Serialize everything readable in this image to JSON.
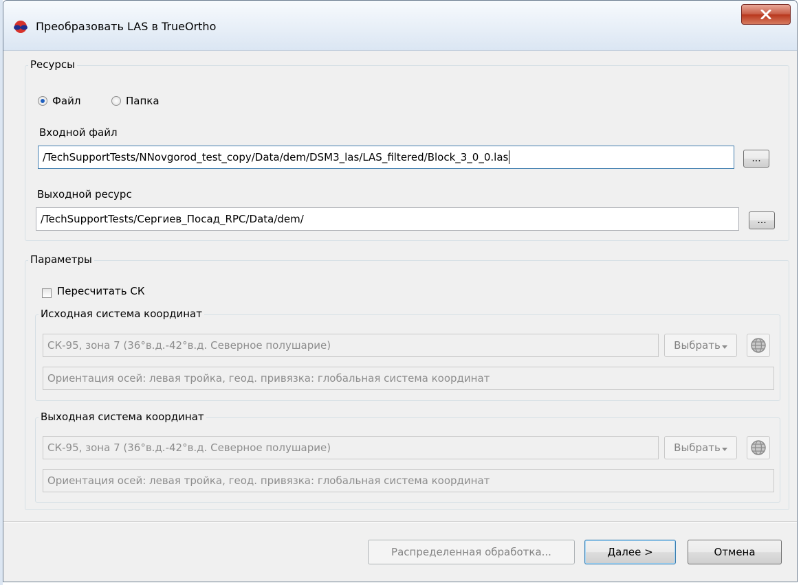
{
  "window": {
    "title": "Преобразовать LAS в TrueOrtho",
    "close_label": "X"
  },
  "resources": {
    "group_title": "Ресурсы",
    "mode_file_label": "Файл",
    "mode_folder_label": "Папка",
    "mode_selected": "file",
    "input_label": "Входной файл",
    "input_value": "/TechSupportTests/NNovgorod_test_copy/Data/dem/DSM3_las/LAS_filtered/Block_3_0_0.las",
    "output_label": "Выходной ресурс",
    "output_value": "/TechSupportTests/Сергиев_Посад_RPC/Data/dem/",
    "browse_label": "..."
  },
  "params": {
    "group_title": "Параметры",
    "recalc_label": "Пересчитать СК",
    "recalc_checked": false,
    "source_cs": {
      "group_title": "Исходная система координат",
      "cs_value": "СК-95, зона 7 (36°в.д.-42°в.д. Северное полушарие)",
      "select_label": "Выбрать",
      "orientation_value": "Ориентация осей: левая тройка, геод. привязка: глобальная система координат"
    },
    "target_cs": {
      "group_title": "Выходная система координат",
      "cs_value": "СК-95, зона 7 (36°в.д.-42°в.д. Северное полушарие)",
      "select_label": "Выбрать",
      "orientation_value": "Ориентация осей: левая тройка, геод. привязка: глобальная система координат"
    }
  },
  "footer": {
    "distributed_label": "Распределенная обработка...",
    "next_label": "Далее >",
    "cancel_label": "Отмена"
  }
}
